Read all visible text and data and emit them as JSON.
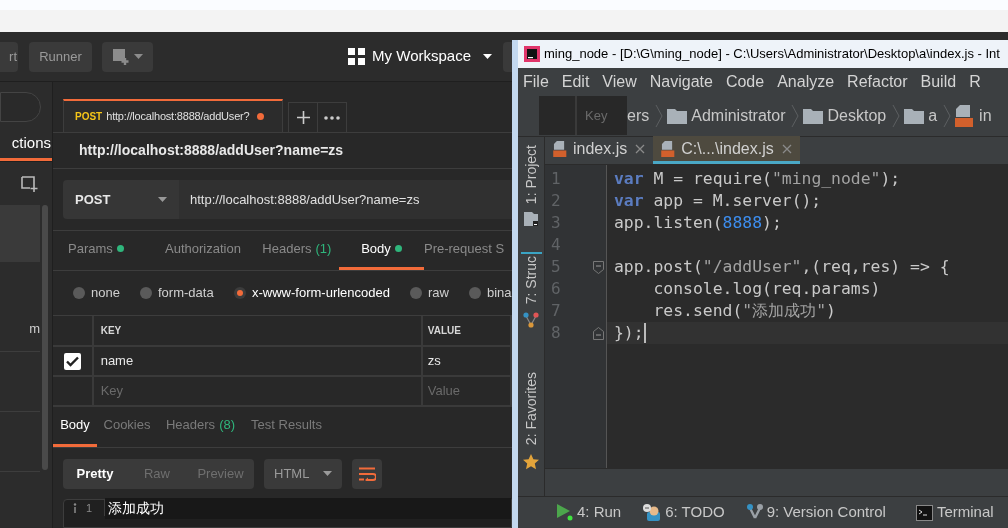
{
  "postman": {
    "header_buttons": [
      {
        "label": "rt"
      },
      {
        "label": "Runner"
      }
    ],
    "workspace": "My Workspace",
    "sidebar": {
      "tab": "ctions",
      "item_text": "m"
    },
    "request_tab": {
      "method": "POST",
      "title": "http://localhost:8888/addUser?",
      "unsaved": true
    },
    "request_name": "http://localhost:8888/addUser?name=zs",
    "method": "POST",
    "url": "http://localhost:8888/addUser?name=zs",
    "request_tabs": [
      {
        "label": "Params",
        "dot": true,
        "selected": false
      },
      {
        "label": "Authorization",
        "dot": false,
        "selected": false
      },
      {
        "label": "Headers",
        "count": "(1)",
        "dot": false,
        "selected": false
      },
      {
        "label": "Body",
        "dot": true,
        "selected": true
      },
      {
        "label": "Pre-request S",
        "dot": false,
        "selected": false
      }
    ],
    "body_modes": [
      {
        "label": "none",
        "selected": false
      },
      {
        "label": "form-data",
        "selected": false
      },
      {
        "label": "x-www-form-urlencoded",
        "selected": true
      },
      {
        "label": "raw",
        "selected": false
      },
      {
        "label": "bina",
        "selected": false
      }
    ],
    "params_table": {
      "columns": [
        "KEY",
        "VALUE"
      ],
      "rows": [
        {
          "checked": true,
          "key": "name",
          "value": "zs"
        }
      ],
      "key_placeholder": "Key",
      "value_placeholder": "Value"
    },
    "response_tabs": [
      {
        "label": "Body",
        "selected": true
      },
      {
        "label": "Cookies",
        "selected": false
      },
      {
        "label": "Headers",
        "count": "(8)",
        "selected": false
      },
      {
        "label": "Test Results",
        "selected": false
      }
    ],
    "view_modes": [
      {
        "label": "Pretty",
        "selected": true
      },
      {
        "label": "Raw",
        "selected": false
      },
      {
        "label": "Preview",
        "selected": false
      }
    ],
    "format": "HTML",
    "response_lines": [
      {
        "number": "1",
        "text": "添加成功"
      }
    ]
  },
  "ide": {
    "title": "ming_node - [D:\\G\\ming_node] - C:\\Users\\Administrator\\Desktop\\a\\index.js - Int",
    "menu": [
      "File",
      "Edit",
      "View",
      "Navigate",
      "Code",
      "Analyze",
      "Refactor",
      "Build",
      "R"
    ],
    "overlay_key": "Key",
    "breadcrumbs": [
      {
        "kind": "text",
        "label": "ers"
      },
      {
        "kind": "folder",
        "label": "Administrator"
      },
      {
        "kind": "folder",
        "label": "Desktop"
      },
      {
        "kind": "folder",
        "label": "a"
      },
      {
        "kind": "js",
        "label": "in"
      }
    ],
    "editor_tabs": [
      {
        "label": "index.js",
        "selected": false
      },
      {
        "label": "C:\\...\\index.js",
        "selected": true
      }
    ],
    "side_tools": [
      {
        "kind": "project",
        "label": "1: Project"
      },
      {
        "kind": "structure",
        "label": "7: Struc"
      },
      {
        "kind": "favorites",
        "label": "2: Favorites"
      }
    ],
    "code": [
      {
        "number": "1",
        "current": false,
        "tokens": [
          {
            "kind": "keyword",
            "text": "var"
          },
          {
            "kind": "plain",
            "text": " M = require("
          },
          {
            "kind": "string",
            "text": "\"ming_node\""
          },
          {
            "kind": "plain",
            "text": ");"
          }
        ]
      },
      {
        "number": "2",
        "current": false,
        "tokens": [
          {
            "kind": "keyword",
            "text": "var"
          },
          {
            "kind": "plain",
            "text": " app = M.server();"
          }
        ]
      },
      {
        "number": "3",
        "current": false,
        "tokens": [
          {
            "kind": "plain",
            "text": "app.listen("
          },
          {
            "kind": "number",
            "text": "8888"
          },
          {
            "kind": "plain",
            "text": ");"
          }
        ]
      },
      {
        "number": "4",
        "current": false
      },
      {
        "number": "5",
        "current": false,
        "kind": "fold_start",
        "tokens": [
          {
            "kind": "plain",
            "text": "app.post("
          },
          {
            "kind": "string",
            "text": "\"/addUser\""
          },
          {
            "kind": "plain",
            "text": ",(req,res) => {"
          }
        ]
      },
      {
        "number": "6",
        "current": false,
        "tokens": [
          {
            "kind": "plain",
            "text": "    console.log(req.params)"
          }
        ]
      },
      {
        "number": "7",
        "current": false,
        "tokens": [
          {
            "kind": "plain",
            "text": "    res.send("
          },
          {
            "kind": "string",
            "text": "\"添加成功\""
          },
          {
            "kind": "plain",
            "text": ")"
          }
        ]
      },
      {
        "number": "8",
        "current": true,
        "kind": "fold_end",
        "tokens": [
          {
            "kind": "plain",
            "text": "});"
          }
        ]
      }
    ],
    "bottom_tools": [
      {
        "kind": "run",
        "label": "4: Run"
      },
      {
        "kind": "todo",
        "label": "6: TODO"
      },
      {
        "kind": "vcs",
        "label": "9: Version Control"
      },
      {
        "kind": "terminal",
        "label": "Terminal"
      }
    ]
  }
}
